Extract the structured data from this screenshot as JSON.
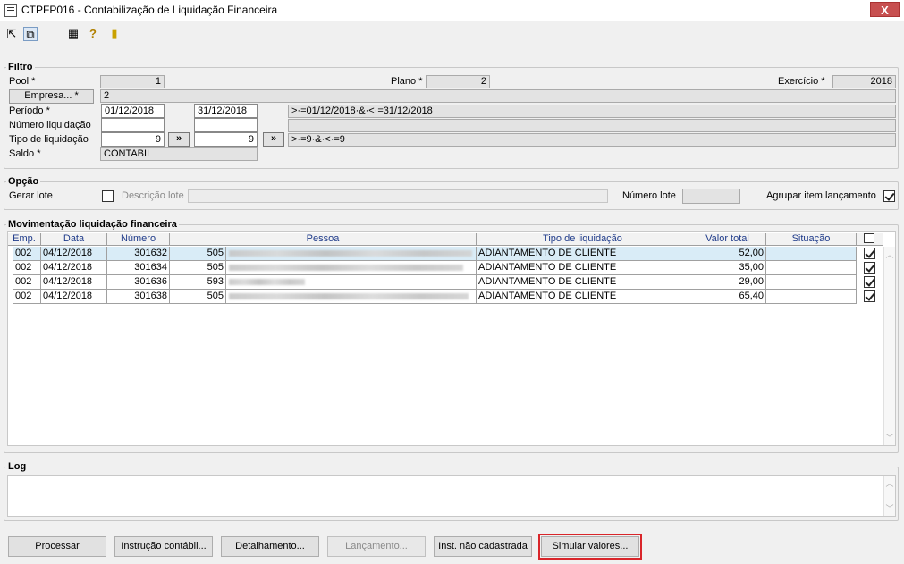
{
  "window": {
    "title": "CTPFP016 - Contabilização de Liquidação Financeira",
    "close": "X"
  },
  "toolbar": {
    "icons": [
      "arrow-icon",
      "copy-icon",
      "grid-icon",
      "help-icon",
      "exit-door-icon"
    ]
  },
  "filtro": {
    "legend": "Filtro",
    "pool_label": "Pool *",
    "pool_value": "1",
    "plano_label": "Plano *",
    "plano_value": "2",
    "exercicio_label": "Exercício *",
    "exercicio_value": "2018",
    "empresa_button": "Empresa... *",
    "empresa_value": "2",
    "periodo_label": "Período *",
    "periodo_from": "01/12/2018",
    "periodo_to": "31/12/2018",
    "periodo_expr": ">·=01/12/2018·&·<·=31/12/2018",
    "numero_label": "Número liquidação",
    "tipo_label": "Tipo de liquidação",
    "tipo_from": "9",
    "tipo_to": "9",
    "tipo_expr": ">·=9·&·<·=9",
    "more_btn": "»",
    "saldo_label": "Saldo *",
    "saldo_value": "CONTABIL"
  },
  "opcao": {
    "legend": "Opção",
    "gerar_lote_label": "Gerar lote",
    "descricao_lote_label": "Descrição lote",
    "numero_lote_label": "Número lote",
    "agrupar_label": "Agrupar item lançamento"
  },
  "mov": {
    "legend": "Movimentação liquidação financeira",
    "columns": [
      "Emp.",
      "Data",
      "Número",
      "Pessoa",
      "Tipo de liquidação",
      "Valor total",
      "Situação"
    ],
    "rows": [
      {
        "emp": "002",
        "data": "04/12/2018",
        "numero": "301632",
        "pessoa_cod": "505",
        "tipo": "ADIANTAMENTO DE CLIENTE",
        "valor": "52,00",
        "situacao": ""
      },
      {
        "emp": "002",
        "data": "04/12/2018",
        "numero": "301634",
        "pessoa_cod": "505",
        "tipo": "ADIANTAMENTO DE CLIENTE",
        "valor": "35,00",
        "situacao": ""
      },
      {
        "emp": "002",
        "data": "04/12/2018",
        "numero": "301636",
        "pessoa_cod": "593",
        "tipo": "ADIANTAMENTO DE CLIENTE",
        "valor": "29,00",
        "situacao": ""
      },
      {
        "emp": "002",
        "data": "04/12/2018",
        "numero": "301638",
        "pessoa_cod": "505",
        "tipo": "ADIANTAMENTO DE CLIENTE",
        "valor": "65,40",
        "situacao": ""
      }
    ]
  },
  "log": {
    "legend": "Log"
  },
  "buttons": {
    "processar": "Processar",
    "instrucao": "Instrução contábil...",
    "detalhamento": "Detalhamento...",
    "lancamento": "Lançamento...",
    "inst_nao_cad": "Inst. não cadastrada",
    "simular": "Simular valores..."
  },
  "colors": {
    "highlight": "#d9252a",
    "selected_row": "#d9ecf7",
    "header_text": "#1f3b8a"
  }
}
